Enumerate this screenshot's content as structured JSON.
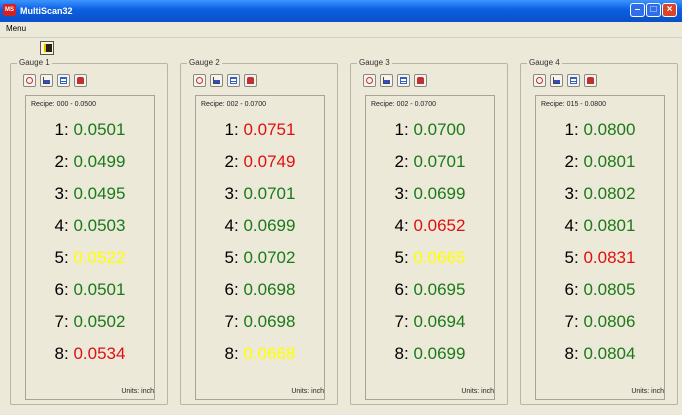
{
  "window": {
    "title": "MultiScan32",
    "app_icon_text": "MS"
  },
  "menubar": {
    "menu_label": "Menu"
  },
  "colors": {
    "ok": "#1a7a1a",
    "alarm": "#e01010",
    "warning": "#ffff00"
  },
  "gauges": [
    {
      "title": "Gauge 1",
      "recipe": "Recipe: 000 - 0.0500",
      "units": "Units: inch",
      "readings": [
        {
          "label": "1:",
          "value": "0.0501",
          "status": "ok"
        },
        {
          "label": "2:",
          "value": "0.0499",
          "status": "ok"
        },
        {
          "label": "3:",
          "value": "0.0495",
          "status": "ok"
        },
        {
          "label": "4:",
          "value": "0.0503",
          "status": "ok"
        },
        {
          "label": "5:",
          "value": "0.0522",
          "status": "warning"
        },
        {
          "label": "6:",
          "value": "0.0501",
          "status": "ok"
        },
        {
          "label": "7:",
          "value": "0.0502",
          "status": "ok"
        },
        {
          "label": "8:",
          "value": "0.0534",
          "status": "alarm"
        }
      ]
    },
    {
      "title": "Gauge 2",
      "recipe": "Recipe: 002 - 0.0700",
      "units": "Units: inch",
      "readings": [
        {
          "label": "1:",
          "value": "0.0751",
          "status": "alarm"
        },
        {
          "label": "2:",
          "value": "0.0749",
          "status": "alarm"
        },
        {
          "label": "3:",
          "value": "0.0701",
          "status": "ok"
        },
        {
          "label": "4:",
          "value": "0.0699",
          "status": "ok"
        },
        {
          "label": "5:",
          "value": "0.0702",
          "status": "ok"
        },
        {
          "label": "6:",
          "value": "0.0698",
          "status": "ok"
        },
        {
          "label": "7:",
          "value": "0.0698",
          "status": "ok"
        },
        {
          "label": "8:",
          "value": "0.0668",
          "status": "warning"
        }
      ]
    },
    {
      "title": "Gauge 3",
      "recipe": "Recipe: 002 - 0.0700",
      "units": "Units: inch",
      "readings": [
        {
          "label": "1:",
          "value": "0.0700",
          "status": "ok"
        },
        {
          "label": "2:",
          "value": "0.0701",
          "status": "ok"
        },
        {
          "label": "3:",
          "value": "0.0699",
          "status": "ok"
        },
        {
          "label": "4:",
          "value": "0.0652",
          "status": "alarm"
        },
        {
          "label": "5:",
          "value": "0.0665",
          "status": "warning"
        },
        {
          "label": "6:",
          "value": "0.0695",
          "status": "ok"
        },
        {
          "label": "7:",
          "value": "0.0694",
          "status": "ok"
        },
        {
          "label": "8:",
          "value": "0.0699",
          "status": "ok"
        }
      ]
    },
    {
      "title": "Gauge 4",
      "recipe": "Recipe: 015 - 0.0800",
      "units": "Units: inch",
      "readings": [
        {
          "label": "1:",
          "value": "0.0800",
          "status": "ok"
        },
        {
          "label": "2:",
          "value": "0.0801",
          "status": "ok"
        },
        {
          "label": "3:",
          "value": "0.0802",
          "status": "ok"
        },
        {
          "label": "4:",
          "value": "0.0801",
          "status": "ok"
        },
        {
          "label": "5:",
          "value": "0.0831",
          "status": "alarm"
        },
        {
          "label": "6:",
          "value": "0.0805",
          "status": "ok"
        },
        {
          "label": "7:",
          "value": "0.0806",
          "status": "ok"
        },
        {
          "label": "8:",
          "value": "0.0804",
          "status": "ok"
        }
      ]
    }
  ]
}
